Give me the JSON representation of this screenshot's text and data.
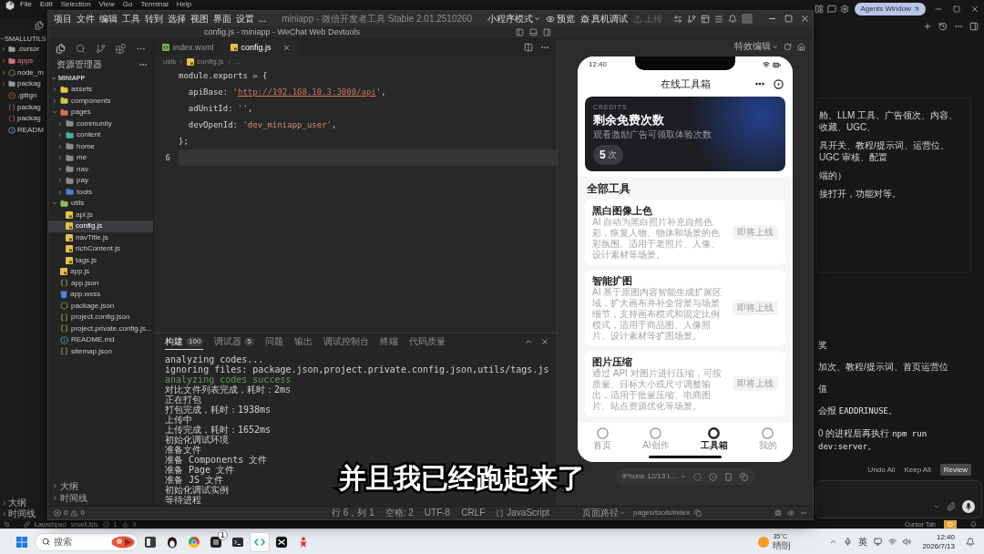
{
  "cursor": {
    "menu": [
      "File",
      "Edit",
      "Selection",
      "View",
      "Go",
      "Terminal",
      "Help"
    ],
    "agents_button": "Agents Window",
    "explorer": {
      "title": "SMALLUTILS",
      "items": [
        {
          "label": ".cursor",
          "kind": "folder",
          "has_errors": false
        },
        {
          "label": "apps",
          "kind": "folder",
          "has_errors": true
        },
        {
          "label": "node_m",
          "kind": "node",
          "has_errors": false
        },
        {
          "label": "packag",
          "kind": "folder",
          "has_errors": false
        },
        {
          "label": ".gitign",
          "kind": "git",
          "has_errors": false
        },
        {
          "label": "packag",
          "kind": "json",
          "has_errors": false
        },
        {
          "label": "packag",
          "kind": "json",
          "has_errors": false
        },
        {
          "label": "READM",
          "kind": "md",
          "has_errors": false
        }
      ]
    },
    "sections": [
      "大纲",
      "时间线"
    ],
    "chat": {
      "card_lines": [
        [
          {
            "text": "舱、LLM 工具、广告领次、内容、收藏、UGC、",
            "kind": "text"
          }
        ],
        [
          {
            "text": "具开关、教程/提示词、运营位、UGC 审核、配置",
            "kind": "text"
          }
        ],
        [
          {
            "text": "端的）",
            "kind": "text"
          }
        ],
        [
          {
            "text": "接打开，功能对等。",
            "kind": "text"
          }
        ]
      ],
      "lines": [
        [
          {
            "text": "奖",
            "kind": "text"
          }
        ],
        [
          {
            "text": "加次、教程/提示词、首页运营位",
            "kind": "text"
          }
        ],
        [
          {
            "text": "值",
            "kind": "text"
          }
        ],
        [
          {
            "text": "会报 ",
            "kind": "text"
          },
          {
            "text": "EADDRINUSE",
            "kind": "code"
          },
          {
            "text": "。",
            "kind": "text"
          }
        ],
        [
          {
            "text": "0 的进程后再执行 ",
            "kind": "text"
          },
          {
            "text": "npm run dev:server",
            "kind": "code"
          },
          {
            "text": "。",
            "kind": "text"
          }
        ]
      ],
      "actions": [
        {
          "label": "Undo All",
          "kind": "text"
        },
        {
          "label": "Keep All",
          "kind": "text"
        },
        {
          "label": "Review",
          "kind": "primary"
        }
      ]
    },
    "status_bar": {
      "items": [
        "Launchpad",
        "smallUtils"
      ],
      "errors": "1",
      "warnings": "0",
      "mode": "Cursor Tab"
    }
  },
  "devtools": {
    "menu": [
      "项目",
      "文件",
      "编辑",
      "工具",
      "转到",
      "选择",
      "视图",
      "界面",
      "设置",
      "..."
    ],
    "app_title": "miniapp - 微信开发者工具 Stable 2.01.2510260",
    "mode": "小程序模式",
    "toolbar": [
      {
        "label": "预览",
        "disabled": false
      },
      {
        "label": "真机调试",
        "disabled": false
      },
      {
        "label": "上传",
        "disabled": true
      }
    ],
    "window_title": "config.js - miniapp - WeChat Web Devtools",
    "explorer": {
      "title": "资源管理器",
      "project": "MINIAPP",
      "tree": [
        {
          "label": "assets",
          "kind": "folder",
          "color": "#e8c547",
          "expanded": false,
          "selected": false
        },
        {
          "label": "components",
          "kind": "folder",
          "color": "#c8c84a",
          "expanded": false,
          "selected": false
        },
        {
          "label": "pages",
          "kind": "folder",
          "color": "#d96b6b",
          "expanded": true,
          "selected": false,
          "children": [
            {
              "label": "community",
              "kind": "folder",
              "color": "#8c8c8c",
              "expanded": false,
              "selected": false
            },
            {
              "label": "content",
              "kind": "folder",
              "color": "#43b5b0",
              "expanded": false,
              "selected": false
            },
            {
              "label": "home",
              "kind": "folder",
              "color": "#8c8c8c",
              "expanded": false,
              "selected": false
            },
            {
              "label": "me",
              "kind": "folder",
              "color": "#8c8c8c",
              "expanded": false,
              "selected": false
            },
            {
              "label": "nav",
              "kind": "folder",
              "color": "#8c8c8c",
              "expanded": false,
              "selected": false
            },
            {
              "label": "pay",
              "kind": "folder",
              "color": "#8c8c8c",
              "expanded": false,
              "selected": false
            },
            {
              "label": "tools",
              "kind": "folder",
              "color": "#4f7fd6",
              "expanded": false,
              "selected": false
            }
          ]
        },
        {
          "label": "utils",
          "kind": "folder",
          "color": "#8fbf5c",
          "expanded": true,
          "selected": false,
          "children": [
            {
              "label": "api.js",
              "kind": "js",
              "selected": false
            },
            {
              "label": "config.js",
              "kind": "js",
              "selected": true
            },
            {
              "label": "navTitle.js",
              "kind": "js",
              "selected": false
            },
            {
              "label": "richContent.js",
              "kind": "js",
              "selected": false
            },
            {
              "label": "tags.js",
              "kind": "js",
              "selected": false
            }
          ]
        },
        {
          "label": "app.js",
          "kind": "js",
          "selected": false
        },
        {
          "label": "app.json",
          "kind": "json",
          "selected": false
        },
        {
          "label": "app.wxss",
          "kind": "wxss",
          "selected": false
        },
        {
          "label": "package.json",
          "kind": "package",
          "selected": false
        },
        {
          "label": "project.config.json",
          "kind": "json",
          "selected": false
        },
        {
          "label": "project.private.config.js...",
          "kind": "json",
          "selected": false
        },
        {
          "label": "README.md",
          "kind": "md",
          "selected": false
        },
        {
          "label": "sitemap.json",
          "kind": "json",
          "selected": false
        }
      ]
    },
    "sections": [
      "大纲",
      "时间线"
    ],
    "problems": {
      "errors": "0",
      "warnings": "0"
    },
    "editor": {
      "tabs": [
        {
          "label": "index.wxml",
          "kind": "wxml",
          "selected": false
        },
        {
          "label": "config.js",
          "kind": "js",
          "selected": true
        }
      ],
      "breadcrumb": [
        "utils",
        "config.js",
        "..."
      ],
      "lines": [
        {
          "current": false,
          "tokens": [
            {
              "text": "module.exports = {",
              "kind": "plain"
            }
          ]
        },
        {
          "current": false,
          "tokens": [
            {
              "text": "  apiBase: ",
              "kind": "plain"
            },
            {
              "text": "'",
              "kind": "string"
            },
            {
              "text": "http://192.168.10.3:3000/api",
              "kind": "link"
            },
            {
              "text": "'",
              "kind": "string"
            },
            {
              "text": ",",
              "kind": "plain"
            }
          ]
        },
        {
          "current": false,
          "tokens": [
            {
              "text": "  adUnitId: ",
              "kind": "plain"
            },
            {
              "text": "''",
              "kind": "string"
            },
            {
              "text": ",",
              "kind": "plain"
            }
          ]
        },
        {
          "current": false,
          "tokens": [
            {
              "text": "  devOpenId: ",
              "kind": "plain"
            },
            {
              "text": "'dev_miniapp_user'",
              "kind": "string"
            },
            {
              "text": ",",
              "kind": "plain"
            }
          ]
        },
        {
          "current": false,
          "tokens": [
            {
              "text": "};",
              "kind": "plain"
            }
          ]
        },
        {
          "current": true,
          "number": "6"
        }
      ]
    },
    "panel": {
      "tabs": [
        {
          "label": "构建",
          "badge": "100",
          "selected": true
        },
        {
          "label": "调试器",
          "badge": "5",
          "selected": false
        },
        {
          "label": "问题",
          "selected": false
        },
        {
          "label": "输出",
          "selected": false
        },
        {
          "label": "调试控制台",
          "selected": false
        },
        {
          "label": "终端",
          "selected": false
        },
        {
          "label": "代码质量",
          "selected": false
        }
      ],
      "lines": [
        {
          "text": "analyzing codes...",
          "kind": "plain"
        },
        {
          "text": "ignoring files: package.json,project.private.config.json,utils/tags.js",
          "kind": "plain"
        },
        {
          "text": "analyzing codes success",
          "kind": "success"
        },
        {
          "text": "对比文件列表完成，耗时：2ms",
          "kind": "plain"
        },
        {
          "text": "正在打包",
          "kind": "plain"
        },
        {
          "text": "打包完成，耗时：1938ms",
          "kind": "plain"
        },
        {
          "text": "上传中",
          "kind": "plain"
        },
        {
          "text": "上传完成，耗时：1652ms",
          "kind": "plain"
        },
        {
          "text": "初始化调试环境",
          "kind": "plain"
        },
        {
          "text": "准备文件",
          "kind": "plain"
        },
        {
          "text": "准备 Components 文件",
          "kind": "plain"
        },
        {
          "text": "准备 Page 文件",
          "kind": "plain"
        },
        {
          "text": "准备 JS 文件",
          "kind": "plain"
        },
        {
          "text": "初始化调试实例",
          "kind": "plain"
        },
        {
          "text": "等待进程",
          "kind": "plain"
        }
      ]
    },
    "status_bar": {
      "items": [
        "行 6，列 1",
        "空格: 2",
        "UTF-8",
        "CRLF"
      ],
      "language": "JavaScript"
    },
    "simulator": {
      "menu": "特效编辑",
      "phone": {
        "time": "12:40",
        "title": "在线工具箱",
        "credits": {
          "eyebrow": "CREDITS",
          "title": "剩余免费次数",
          "subtitle": "观看激励广告可领取体验次数",
          "count": "5",
          "unit": "次"
        },
        "section_title": "全部工具",
        "tools": [
          {
            "title": "黑白图像上色",
            "description": "AI 自动为黑白照片补充自然色彩，恢复人物、物体和场景的色彩氛围。适用于老照片、人像、设计素材等场景。",
            "action": "即将上线"
          },
          {
            "title": "智能扩图",
            "description": "AI 基于原图内容智能生成扩展区域，扩大画布并补全背景与场景细节，支持画布模式和固定比例模式，适用于商品图、人像照片、设计素材等扩图场景。",
            "action": "即将上线"
          },
          {
            "title": "图片压缩",
            "description": "通过 API 对图片进行压缩，可按质量、目标大小或尺寸调整输出，适用于批量压缩、电商图片、站点资源优化等场景。",
            "action": "即将上线"
          }
        ],
        "tab_bar": [
          {
            "label": "首页",
            "selected": false
          },
          {
            "label": "AI创作",
            "selected": false
          },
          {
            "label": "工具箱",
            "selected": true
          },
          {
            "label": "我的",
            "selected": false
          }
        ]
      },
      "device": "iPhone 12/13 L…",
      "path_label": "页面路径",
      "path": "pages/tools/index"
    }
  },
  "subtitle": "并且我已经跑起来了",
  "taskbar": {
    "search_placeholder": "搜索",
    "apps": [
      {
        "selected": false
      },
      {
        "selected": false
      },
      {
        "selected": false
      },
      {
        "selected": false,
        "badge": "1"
      },
      {
        "selected": false
      },
      {
        "selected": true
      },
      {
        "selected": false
      },
      {
        "selected": false
      }
    ],
    "weather": {
      "temperature": "35°C",
      "condition": "晴朗"
    },
    "input_method": "英",
    "time": "12:40",
    "date": "2026/7/13"
  }
}
